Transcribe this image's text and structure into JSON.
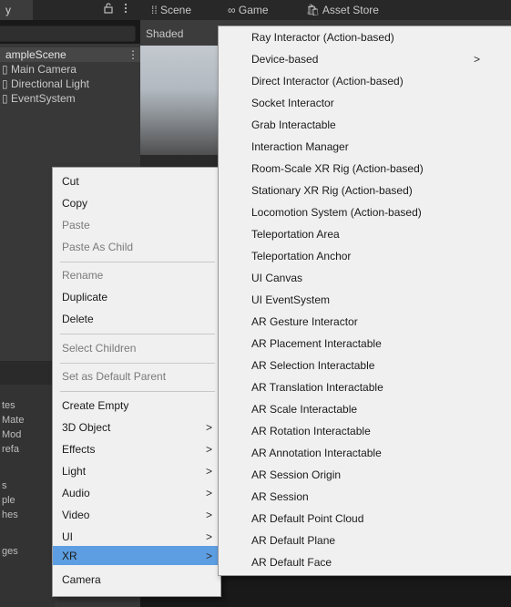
{
  "hierarchy": {
    "tab_label": "y",
    "lock_icon": "lock-icon",
    "more_icon": "kebab-icon",
    "scene_name": "ampleScene",
    "scene_more": "⋮",
    "items": [
      "▯ Main Camera",
      "▯ Directional Light",
      "▯ EventSystem"
    ],
    "lower_fragments": [
      "tes",
      "Mate",
      "Mod",
      "refa",
      "s",
      "ple",
      "hes",
      "ges"
    ]
  },
  "scene_view": {
    "tabs": [
      "⁞⁞ Scene",
      "∞ Game",
      "🛍 Asset Store"
    ],
    "shading_mode": "Shaded"
  },
  "context_menu": {
    "items": [
      {
        "label": "Cut",
        "enabled": true
      },
      {
        "label": "Copy",
        "enabled": true
      },
      {
        "label": "Paste",
        "enabled": false
      },
      {
        "label": "Paste As Child",
        "enabled": false
      },
      {
        "label": "Rename",
        "enabled": false
      },
      {
        "label": "Duplicate",
        "enabled": true
      },
      {
        "label": "Delete",
        "enabled": true
      },
      {
        "label": "Select Children",
        "enabled": false
      },
      {
        "label": "Set as Default Parent",
        "enabled": false
      },
      {
        "label": "Create Empty",
        "enabled": true
      },
      {
        "label": "3D Object",
        "enabled": true,
        "submenu": true
      },
      {
        "label": "Effects",
        "enabled": true,
        "submenu": true
      },
      {
        "label": "Light",
        "enabled": true,
        "submenu": true
      },
      {
        "label": "Audio",
        "enabled": true,
        "submenu": true
      },
      {
        "label": "Video",
        "enabled": true,
        "submenu": true
      },
      {
        "label": "UI",
        "enabled": true,
        "submenu": true
      },
      {
        "label": "XR",
        "enabled": true,
        "submenu": true,
        "selected": true
      },
      {
        "label": "Camera",
        "enabled": true
      }
    ],
    "arrow_glyph": ">",
    "selected_color": "#5d9ee2"
  },
  "xr_submenu": {
    "items": [
      {
        "label": "Ray Interactor (Action-based)"
      },
      {
        "label": "Device-based",
        "submenu": true
      },
      {
        "label": "Direct Interactor (Action-based)"
      },
      {
        "label": "Socket Interactor"
      },
      {
        "label": "Grab Interactable"
      },
      {
        "label": "Interaction Manager"
      },
      {
        "label": "Room-Scale XR Rig (Action-based)"
      },
      {
        "label": "Stationary XR Rig (Action-based)"
      },
      {
        "label": "Locomotion System (Action-based)"
      },
      {
        "label": "Teleportation Area"
      },
      {
        "label": "Teleportation Anchor"
      },
      {
        "label": "UI Canvas"
      },
      {
        "label": "UI EventSystem"
      },
      {
        "label": "AR Gesture Interactor"
      },
      {
        "label": "AR Placement Interactable"
      },
      {
        "label": "AR Selection Interactable"
      },
      {
        "label": "AR Translation Interactable"
      },
      {
        "label": "AR Scale Interactable"
      },
      {
        "label": "AR Rotation Interactable"
      },
      {
        "label": "AR Annotation Interactable"
      },
      {
        "label": "AR Session Origin"
      },
      {
        "label": "AR Session"
      },
      {
        "label": "AR Default Point Cloud"
      },
      {
        "label": "AR Default Plane"
      },
      {
        "label": "AR Default Face"
      }
    ],
    "arrow_glyph": ">"
  }
}
